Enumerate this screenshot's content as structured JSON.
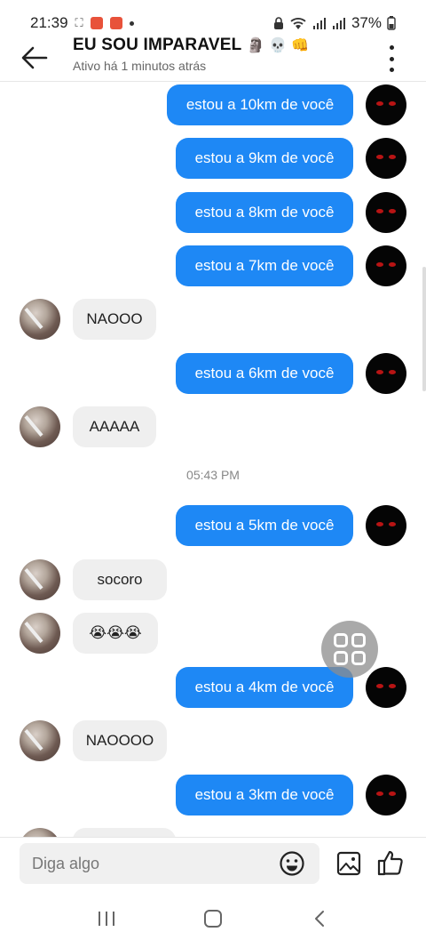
{
  "status": {
    "time": "21:39",
    "battery": "37%"
  },
  "header": {
    "title": "EU SOU IMPARAVEL",
    "title_emojis": "🗿 💀 👊",
    "subtitle": "Ativo há 1 minutos atrás"
  },
  "messages": [
    {
      "dir": "out",
      "text": "estou a 10km de você"
    },
    {
      "dir": "out",
      "text": "estou a 9km de você"
    },
    {
      "dir": "out",
      "text": "estou a 8km de você"
    },
    {
      "dir": "out",
      "text": "estou a 7km de você"
    },
    {
      "dir": "in",
      "text": "NAOOO"
    },
    {
      "dir": "out",
      "text": "estou a 6km de você"
    },
    {
      "dir": "in",
      "text": "AAAAA"
    },
    {
      "dir": "time",
      "text": "05:43 PM"
    },
    {
      "dir": "out",
      "text": "estou a 5km de você"
    },
    {
      "dir": "in",
      "text": "socoro"
    },
    {
      "dir": "in",
      "text": "😭😭😭"
    },
    {
      "dir": "out",
      "text": "estou a 4km de você"
    },
    {
      "dir": "in",
      "text": "NAOOOO"
    },
    {
      "dir": "out",
      "text": "estou a 3km de você"
    }
  ],
  "composer": {
    "placeholder": "Diga algo"
  },
  "colors": {
    "outgoing_bubble": "#1e88f5",
    "incoming_bubble": "#efefef"
  }
}
